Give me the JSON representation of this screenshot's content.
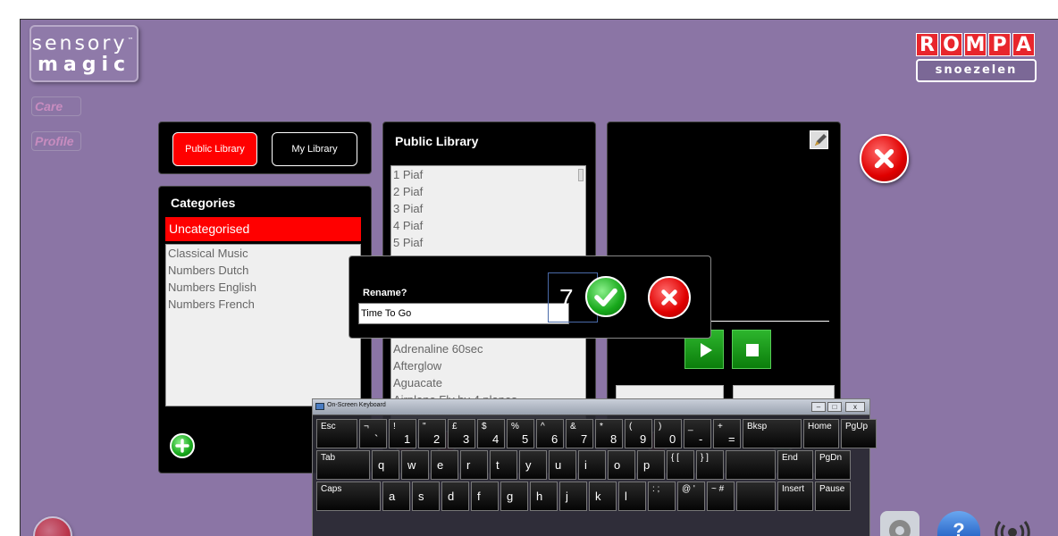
{
  "app": {
    "logo_line1": "sensory",
    "logo_tm": "™",
    "logo_line2": "magic",
    "rompa_letters": [
      "R",
      "O",
      "M",
      "P",
      "A"
    ],
    "snoezelen": "snoezelen",
    "side_tag_1": "Care",
    "side_tag_2": "Profile"
  },
  "library_switch": {
    "public_label": "Public Library",
    "my_label": "My Library",
    "active": "Public Library"
  },
  "categories": {
    "title": "Categories",
    "selected": "Uncategorised",
    "items": [
      "Classical Music",
      "Numbers Dutch",
      "Numbers English",
      "Numbers French"
    ]
  },
  "public_library": {
    "title": "Public Library",
    "items_top": [
      "1 Piaf",
      "2 Piaf",
      "3 Piaf",
      "4 Piaf",
      "5 Piaf"
    ],
    "items_bottom": [
      "Adrenaline 60sec",
      "Afterglow",
      "Aguacate",
      "Airplane Fly by 4 planes"
    ]
  },
  "rename_dialog": {
    "label": "Rename?",
    "value": "Time To Go",
    "annotation_number": "7"
  },
  "keyboard": {
    "title": "On-Screen Keyboard",
    "controls": [
      "–",
      "□",
      "x"
    ],
    "row1": [
      {
        "top": "Esc",
        "bottom": ""
      },
      {
        "top": "¬",
        "bottom": "`"
      },
      {
        "top": "!",
        "bottom": "1"
      },
      {
        "top": "\"",
        "bottom": "2"
      },
      {
        "top": "£",
        "bottom": "3"
      },
      {
        "top": "$",
        "bottom": "4"
      },
      {
        "top": "%",
        "bottom": "5"
      },
      {
        "top": "^",
        "bottom": "6"
      },
      {
        "top": "&",
        "bottom": "7"
      },
      {
        "top": "*",
        "bottom": "8"
      },
      {
        "top": "(",
        "bottom": "9"
      },
      {
        "top": ")",
        "bottom": "0"
      },
      {
        "top": "_",
        "bottom": "-"
      },
      {
        "top": "+",
        "bottom": "="
      },
      {
        "top": "Bksp",
        "bottom": ""
      },
      {
        "top": "Home",
        "bottom": ""
      },
      {
        "top": "PgUp",
        "bottom": ""
      }
    ],
    "row2": [
      "Tab",
      "q",
      "w",
      "e",
      "r",
      "t",
      "y",
      "u",
      "i",
      "o",
      "p",
      "{ [",
      "} ]",
      "",
      "End",
      "PgDn"
    ],
    "row3": [
      "Caps",
      "a",
      "s",
      "d",
      "f",
      "g",
      "h",
      "j",
      "k",
      "l",
      ": ;",
      "@ '",
      "~ #",
      "",
      "Insert",
      "Pause"
    ]
  },
  "colors": {
    "background": "#8b75a5",
    "accent_red": "#ff0000",
    "play_green": "#1b9e1b"
  }
}
